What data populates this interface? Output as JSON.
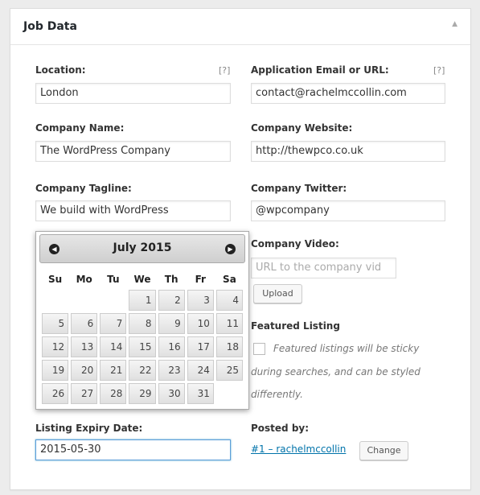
{
  "metabox": {
    "title": "Job Data",
    "toggle_icon": "triangle-up-icon"
  },
  "fields": {
    "location": {
      "label": "Location:",
      "help": "[?]",
      "value": "London"
    },
    "application": {
      "label": "Application Email or URL:",
      "help": "[?]",
      "value": "contact@rachelmccollin.com"
    },
    "company_name": {
      "label": "Company Name:",
      "value": "The WordPress Company"
    },
    "company_website": {
      "label": "Company Website:",
      "value": "http://thewpco.co.uk"
    },
    "company_tagline": {
      "label": "Company Tagline:",
      "value": "We build with WordPress"
    },
    "company_twitter": {
      "label": "Company Twitter:",
      "value": "@wpcompany"
    },
    "company_video": {
      "label": "Company Video:",
      "placeholder": "URL to the company vid",
      "upload_label": "Upload"
    },
    "featured": {
      "label": "Featured Listing",
      "desc_line1": "Featured listings will be sticky",
      "desc_line2": "during searches, and can be styled",
      "desc_line3": "differently."
    },
    "expiry": {
      "label": "Listing Expiry Date:",
      "value": "2015-05-30"
    },
    "posted_by": {
      "label": "Posted by:",
      "link": "#1 – rachelmccollin",
      "change_label": "Change"
    }
  },
  "datepicker": {
    "title": "July 2015",
    "prev_icon": "circle-prev-icon",
    "next_icon": "circle-next-icon",
    "weekdays": [
      "Su",
      "Mo",
      "Tu",
      "We",
      "Th",
      "Fr",
      "Sa"
    ],
    "weeks": [
      [
        "",
        "",
        "",
        "1",
        "2",
        "3",
        "4"
      ],
      [
        "5",
        "6",
        "7",
        "8",
        "9",
        "10",
        "11"
      ],
      [
        "12",
        "13",
        "14",
        "15",
        "16",
        "17",
        "18"
      ],
      [
        "19",
        "20",
        "21",
        "22",
        "23",
        "24",
        "25"
      ],
      [
        "26",
        "27",
        "28",
        "29",
        "30",
        "31",
        ""
      ]
    ]
  }
}
